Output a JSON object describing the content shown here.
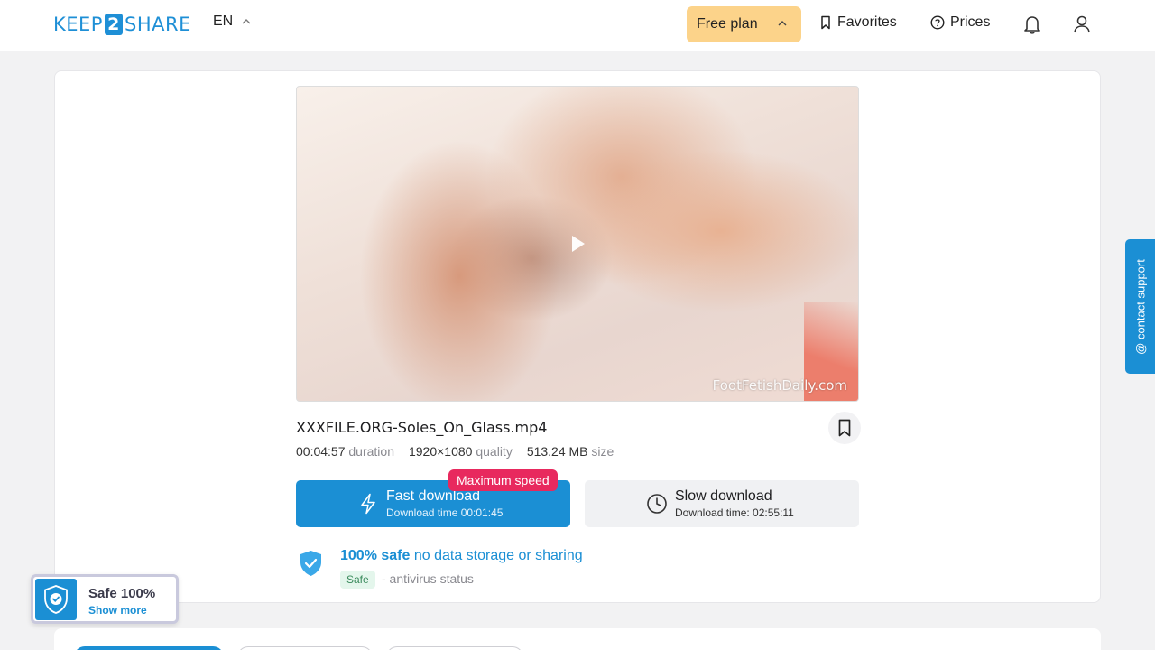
{
  "header": {
    "logo": {
      "part1": "KEEP",
      "part2": "2",
      "part3": "SHARE"
    },
    "language": "EN",
    "plan_button": "Free plan",
    "favorites": "Favorites",
    "prices": "Prices",
    "icons": [
      "chevron-up-icon",
      "bookmark-icon",
      "question-circle-icon",
      "bell-icon",
      "user-icon"
    ]
  },
  "file": {
    "preview_watermark": "FootFetishDaily.com",
    "name": "XXXFILE.ORG-Soles_On_Glass.mp4",
    "duration_value": "00:04:57",
    "duration_label": "duration",
    "quality_value": "1920×1080",
    "quality_label": "quality",
    "size_value": "513.24 MB",
    "size_label": "size"
  },
  "download": {
    "badge": "Maximum speed",
    "fast_title": "Fast download",
    "fast_time": "Download time 00:01:45",
    "slow_title": "Slow download",
    "slow_time": "Download time: 02:55:11"
  },
  "safety": {
    "strong": "100% safe",
    "light": "no data storage or sharing",
    "pill": "Safe",
    "status": "- antivirus status"
  },
  "support": {
    "label": "@ contact support"
  },
  "safe_widget": {
    "title": "Safe 100%",
    "link": "Show more"
  },
  "colors": {
    "accent": "#1b8fd4",
    "plan": "#fcd38a",
    "badge": "#e8295e"
  }
}
